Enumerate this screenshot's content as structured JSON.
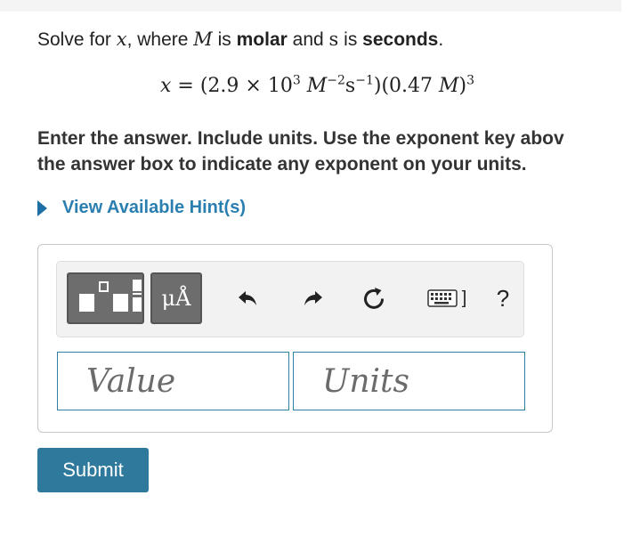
{
  "prompt": {
    "text1": "Solve for ",
    "var_x": "x",
    "text2": ", where ",
    "var_M": "M",
    "text3": " is ",
    "molar": "molar",
    "text4": " and ",
    "var_s": "s",
    "text5": " is ",
    "seconds": "seconds",
    "text6": "."
  },
  "equation": {
    "lhs": "x",
    "equals": " = (2.9 × 10",
    "exp1": "3",
    "M1": " M",
    "exp2": "−2",
    "s": "s",
    "exp3": "−1",
    "mid": ")(0.47 ",
    "M2": "M",
    "close": ")",
    "exp4": "3"
  },
  "instructions": {
    "line1": "Enter the answer. Include units. Use the exponent key abov",
    "line2": "the answer box to indicate any exponent on your units."
  },
  "hint": {
    "label": "View Available Hint(s)"
  },
  "toolbar": {
    "units_glyph": "μÅ",
    "help_label": "?",
    "keyboard_bracket": "]"
  },
  "inputs": {
    "value_placeholder": "Value",
    "units_placeholder": "Units"
  },
  "submit": {
    "label": "Submit"
  },
  "colors": {
    "accent": "#2f7a9c",
    "link": "#2a7fb0",
    "tool_button": "#6d6d6d"
  },
  "icons": [
    "templates-icon",
    "units-icon",
    "undo-icon",
    "redo-icon",
    "reset-icon",
    "keyboard-icon",
    "help-icon",
    "hint-arrow-icon"
  ]
}
